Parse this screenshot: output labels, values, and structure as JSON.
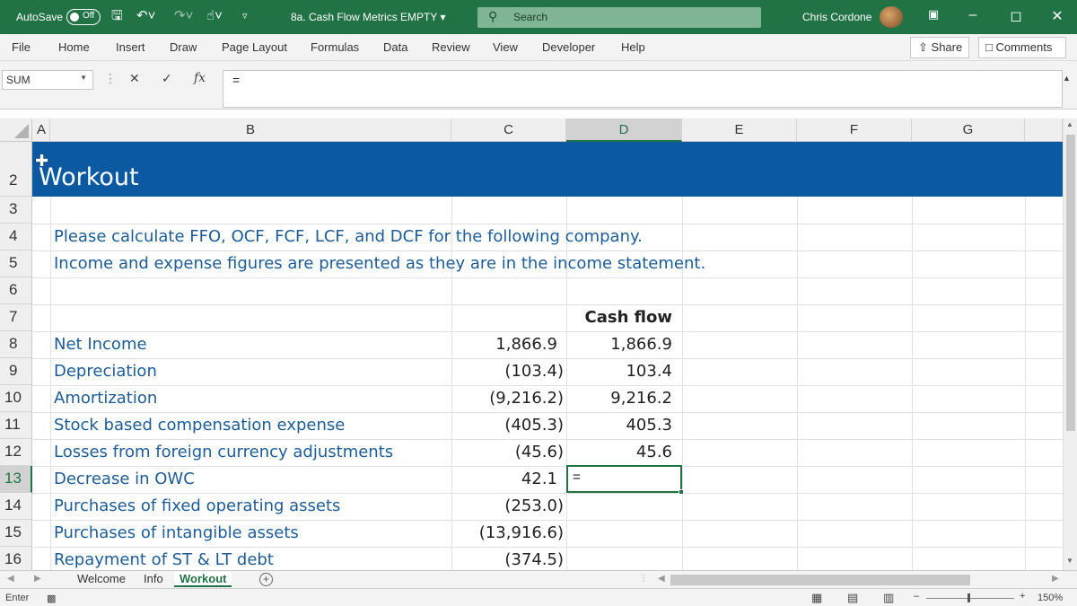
{
  "titlebar": {
    "autosave_label": "AutoSave",
    "autosave_state": "Off",
    "doc_title": "8a. Cash Flow Metrics EMPTY",
    "search_placeholder": "Search",
    "user_name": "Chris Cordone",
    "accent_color": "#217346"
  },
  "ribbon": {
    "tabs": [
      "File",
      "Home",
      "Insert",
      "Draw",
      "Page Layout",
      "Formulas",
      "Data",
      "Review",
      "View",
      "Developer",
      "Help"
    ],
    "share_label": "Share",
    "comments_label": "Comments"
  },
  "formula_bar": {
    "name_box": "SUM",
    "fx_label": "fx",
    "formula": "="
  },
  "grid": {
    "columns": [
      "A",
      "B",
      "C",
      "D",
      "E",
      "F",
      "G"
    ],
    "active_column": "D",
    "rows": [
      "2",
      "3",
      "4",
      "5",
      "6",
      "7",
      "8",
      "9",
      "10",
      "11",
      "12",
      "13",
      "14",
      "15",
      "16"
    ],
    "active_row": "13",
    "banner_title": "Workout",
    "instruction_1": "Please calculate FFO, OCF, FCF, LCF, and DCF for the following company.",
    "instruction_2": "Income and expense figures are presented as they are in the income statement.",
    "cash_flow_header": "Cash flow",
    "items": [
      {
        "label": "Net Income",
        "value": "1,866.9",
        "cash_flow": "1,866.9"
      },
      {
        "label": "Depreciation",
        "value": "(103.4)",
        "cash_flow": "103.4"
      },
      {
        "label": "Amortization",
        "value": "(9,216.2)",
        "cash_flow": "9,216.2"
      },
      {
        "label": "Stock based compensation expense",
        "value": "(405.3)",
        "cash_flow": "405.3"
      },
      {
        "label": "Losses from foreign currency adjustments",
        "value": "(45.6)",
        "cash_flow": "45.6"
      },
      {
        "label": "Decrease in OWC",
        "value": "42.1",
        "cash_flow": ""
      },
      {
        "label": "Purchases of fixed operating assets",
        "value": "(253.0)",
        "cash_flow": ""
      },
      {
        "label": "Purchases of intangible assets",
        "value": "(13,916.6)",
        "cash_flow": ""
      },
      {
        "label": "Repayment of ST & LT debt",
        "value": "(374.5)",
        "cash_flow": ""
      }
    ],
    "editing_value": "=",
    "banner_color": "#0b5aa1",
    "text_color": "#1f5b94"
  },
  "sheets": {
    "tabs": [
      "Welcome",
      "Info",
      "Workout"
    ],
    "active": "Workout"
  },
  "status": {
    "mode": "Enter",
    "zoom": "150%"
  }
}
